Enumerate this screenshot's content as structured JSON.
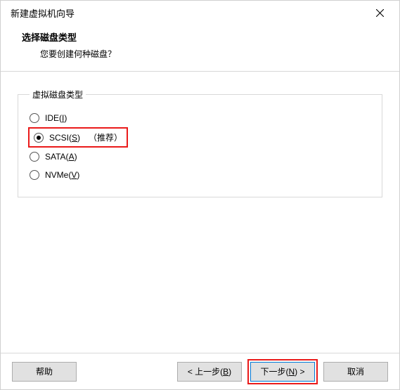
{
  "window": {
    "title": "新建虚拟机向导"
  },
  "header": {
    "heading": "选择磁盘类型",
    "question": "您要创建何种磁盘？"
  },
  "group": {
    "legend": "虚拟磁盘类型",
    "options": [
      {
        "label_prefix": "IDE(",
        "accel": "I",
        "label_suffix": ")",
        "checked": false
      },
      {
        "label_prefix": "SCSI(",
        "accel": "S",
        "label_suffix": ")",
        "checked": true,
        "recommend": "（推荐）"
      },
      {
        "label_prefix": "SATA(",
        "accel": "A",
        "label_suffix": ")",
        "checked": false
      },
      {
        "label_prefix": "NVMe(",
        "accel": "V",
        "label_suffix": ")",
        "checked": false
      }
    ]
  },
  "buttons": {
    "help": "帮助",
    "back_prefix": "< 上一步(",
    "back_accel": "B",
    "back_suffix": ")",
    "next_prefix": "下一步(",
    "next_accel": "N",
    "next_suffix": ") >",
    "cancel": "取消"
  }
}
